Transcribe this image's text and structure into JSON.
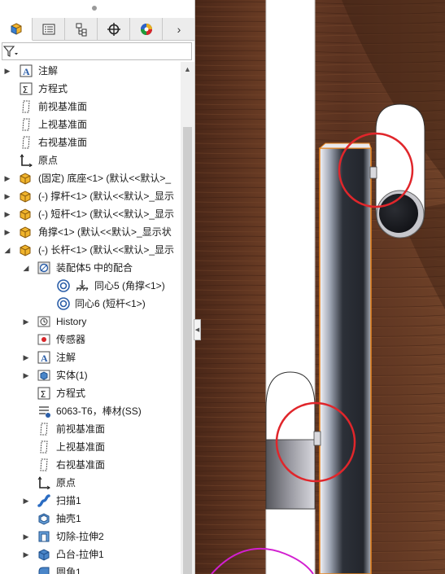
{
  "tabs": [
    {
      "icon": "feature-manager-icon",
      "active": true
    },
    {
      "icon": "property-manager-icon"
    },
    {
      "icon": "configuration-manager-icon"
    },
    {
      "icon": "dimxpert-icon"
    },
    {
      "icon": "display-manager-icon"
    }
  ],
  "more_tabs": "›",
  "tree": [
    {
      "label": "注解"
    },
    {
      "label": "方程式"
    },
    {
      "label": "前视基准面"
    },
    {
      "label": "上视基准面"
    },
    {
      "label": "右视基准面"
    },
    {
      "label": "原点"
    },
    {
      "label": "(固定) 底座<1> (默认<<默认>_"
    },
    {
      "label": "(-) 撑杆<1> (默认<<默认>_显示"
    },
    {
      "label": "(-) 短杆<1> (默认<<默认>_显示"
    },
    {
      "label": "角撑<1> (默认<<默认>_显示状"
    },
    {
      "label": "(-) 长杆<1> (默认<<默认>_显示"
    },
    {
      "label": "装配体5 中的配合"
    },
    {
      "label": "同心5 (角撑<1>)"
    },
    {
      "label": "同心6 (短杆<1>)"
    },
    {
      "label": "History"
    },
    {
      "label": "传感器"
    },
    {
      "label": "注解"
    },
    {
      "label": "实体(1)"
    },
    {
      "label": "方程式"
    },
    {
      "label": "6063-T6，棒材(SS)"
    },
    {
      "label": "前视基准面"
    },
    {
      "label": "上视基准面"
    },
    {
      "label": "右视基准面"
    },
    {
      "label": "原点"
    },
    {
      "label": "扫描1"
    },
    {
      "label": "抽壳1"
    },
    {
      "label": "切除-拉伸2"
    },
    {
      "label": "凸台-拉伸1"
    },
    {
      "label": "圆角1"
    }
  ],
  "colors": {
    "wood": "#5a3220",
    "highlight_circle": "#e0262b",
    "sketch_curve": "#d21fd0"
  }
}
